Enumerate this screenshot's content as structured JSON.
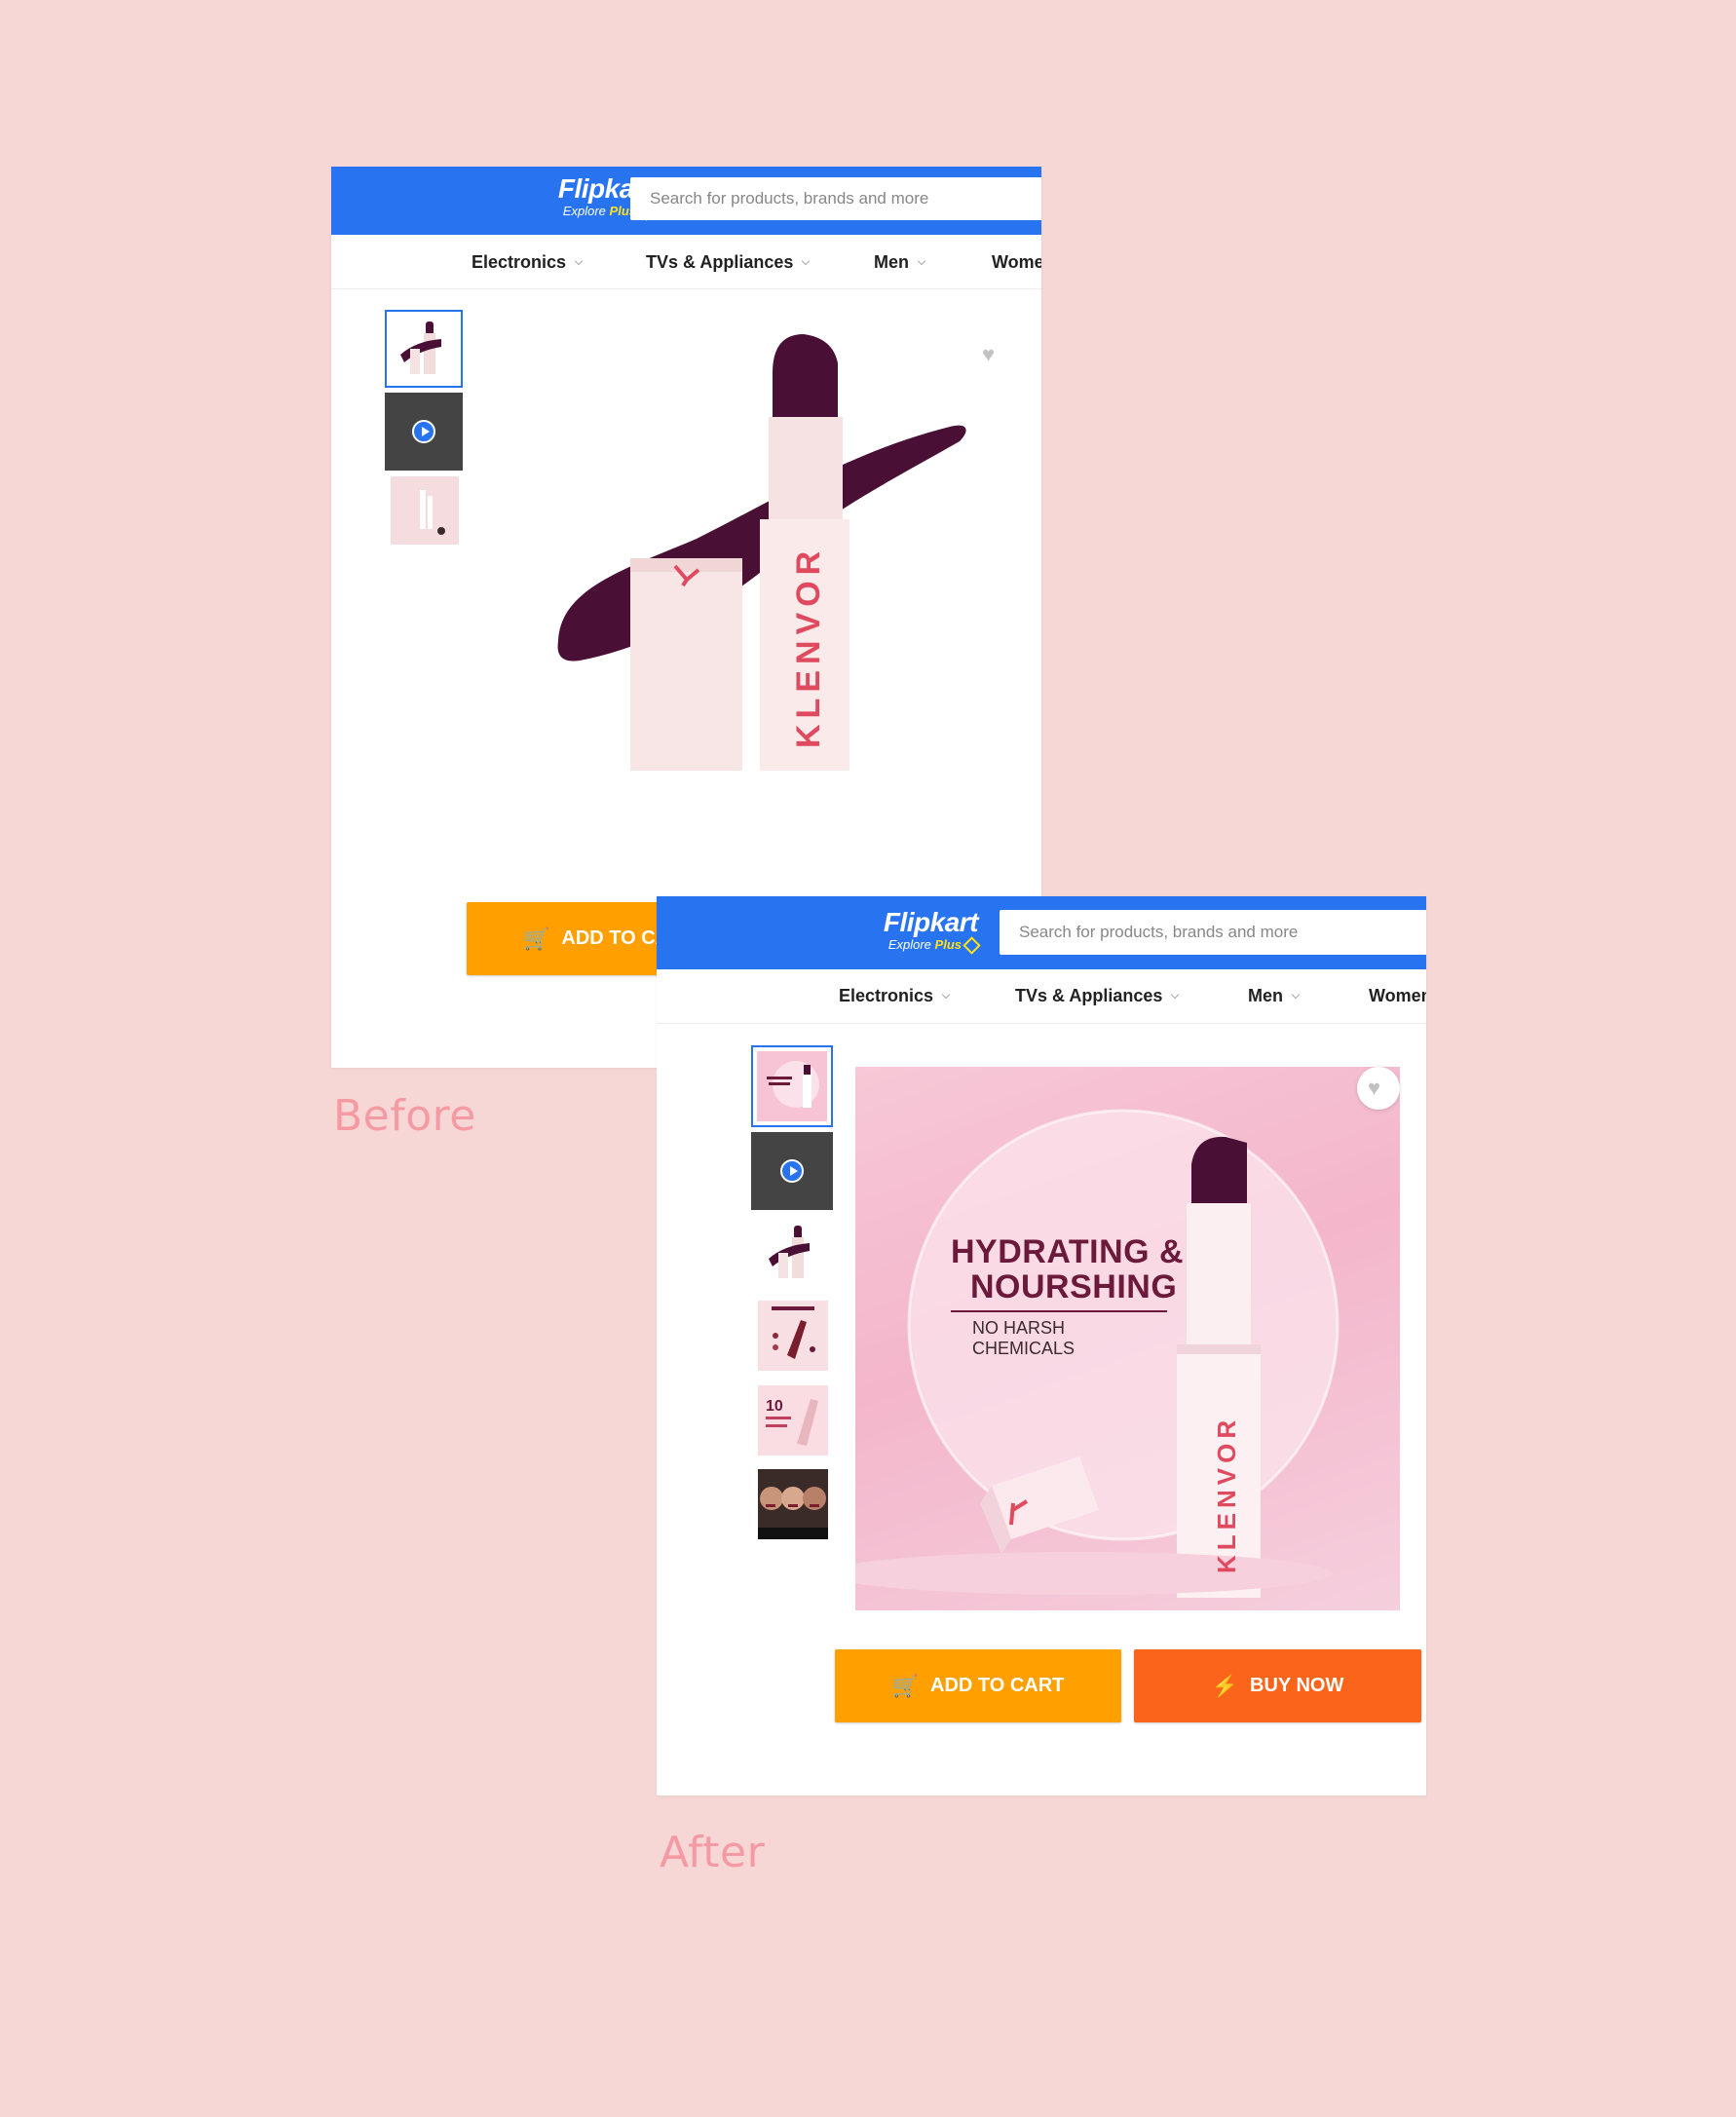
{
  "before": {
    "header": {
      "logo_text": "Flipkart",
      "tagline_prefix": "Explore",
      "tagline_plus": "Plus",
      "search_placeholder": "Search for products, brands and more"
    },
    "nav": [
      "Electronics",
      "TVs & Appliances",
      "Men",
      "Wome"
    ],
    "product_brand": "KLENVOR",
    "add_to_cart": "ADD TO CA",
    "caption": "Before"
  },
  "after": {
    "header": {
      "logo_text": "Flipkart",
      "tagline_prefix": "Explore",
      "tagline_plus": "Plus",
      "search_placeholder": "Search for products, brands and more"
    },
    "nav": [
      "Electronics",
      "TVs & Appliances",
      "Men",
      "Women"
    ],
    "banner": {
      "headline_1": "HYDRATING &",
      "headline_2": "NOURSHING",
      "subline": "NO HARSH CHEMICALS",
      "product_brand": "KLENVOR",
      "thumb_number": "10"
    },
    "add_to_cart": "ADD TO CART",
    "buy_now": "BUY NOW",
    "caption": "After"
  },
  "colors": {
    "page_bg": "#f6d7d6",
    "flipkart_blue": "#2874f0",
    "cart_orange": "#ff9f00",
    "buy_orange": "#fb641b",
    "lipstick_plum": "#4a0f35",
    "caption_pink": "#f59aa3"
  },
  "icons": [
    "heart-icon",
    "cart-icon",
    "bolt-icon",
    "play-icon",
    "chevron-down-icon"
  ]
}
